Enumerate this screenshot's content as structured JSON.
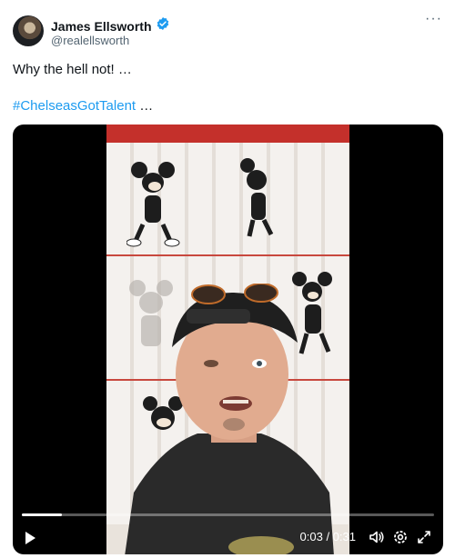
{
  "tweet": {
    "display_name": "James Ellsworth",
    "handle": "@realellsworth",
    "text_line1": "Why the hell not! …",
    "hashtag": "#ChelseasGotTalent",
    "hashtag_suffix": " …",
    "more_label": "···"
  },
  "video": {
    "time_display": "0:03 / 0:31",
    "progress_fraction": 0.097
  },
  "colors": {
    "hashtag": "#1d9bf0",
    "verified": "#1d9bf0",
    "secondary_text": "#536471"
  },
  "icons": [
    "verified-icon",
    "more-icon",
    "play-icon",
    "volume-icon",
    "settings-icon",
    "fullscreen-icon"
  ]
}
